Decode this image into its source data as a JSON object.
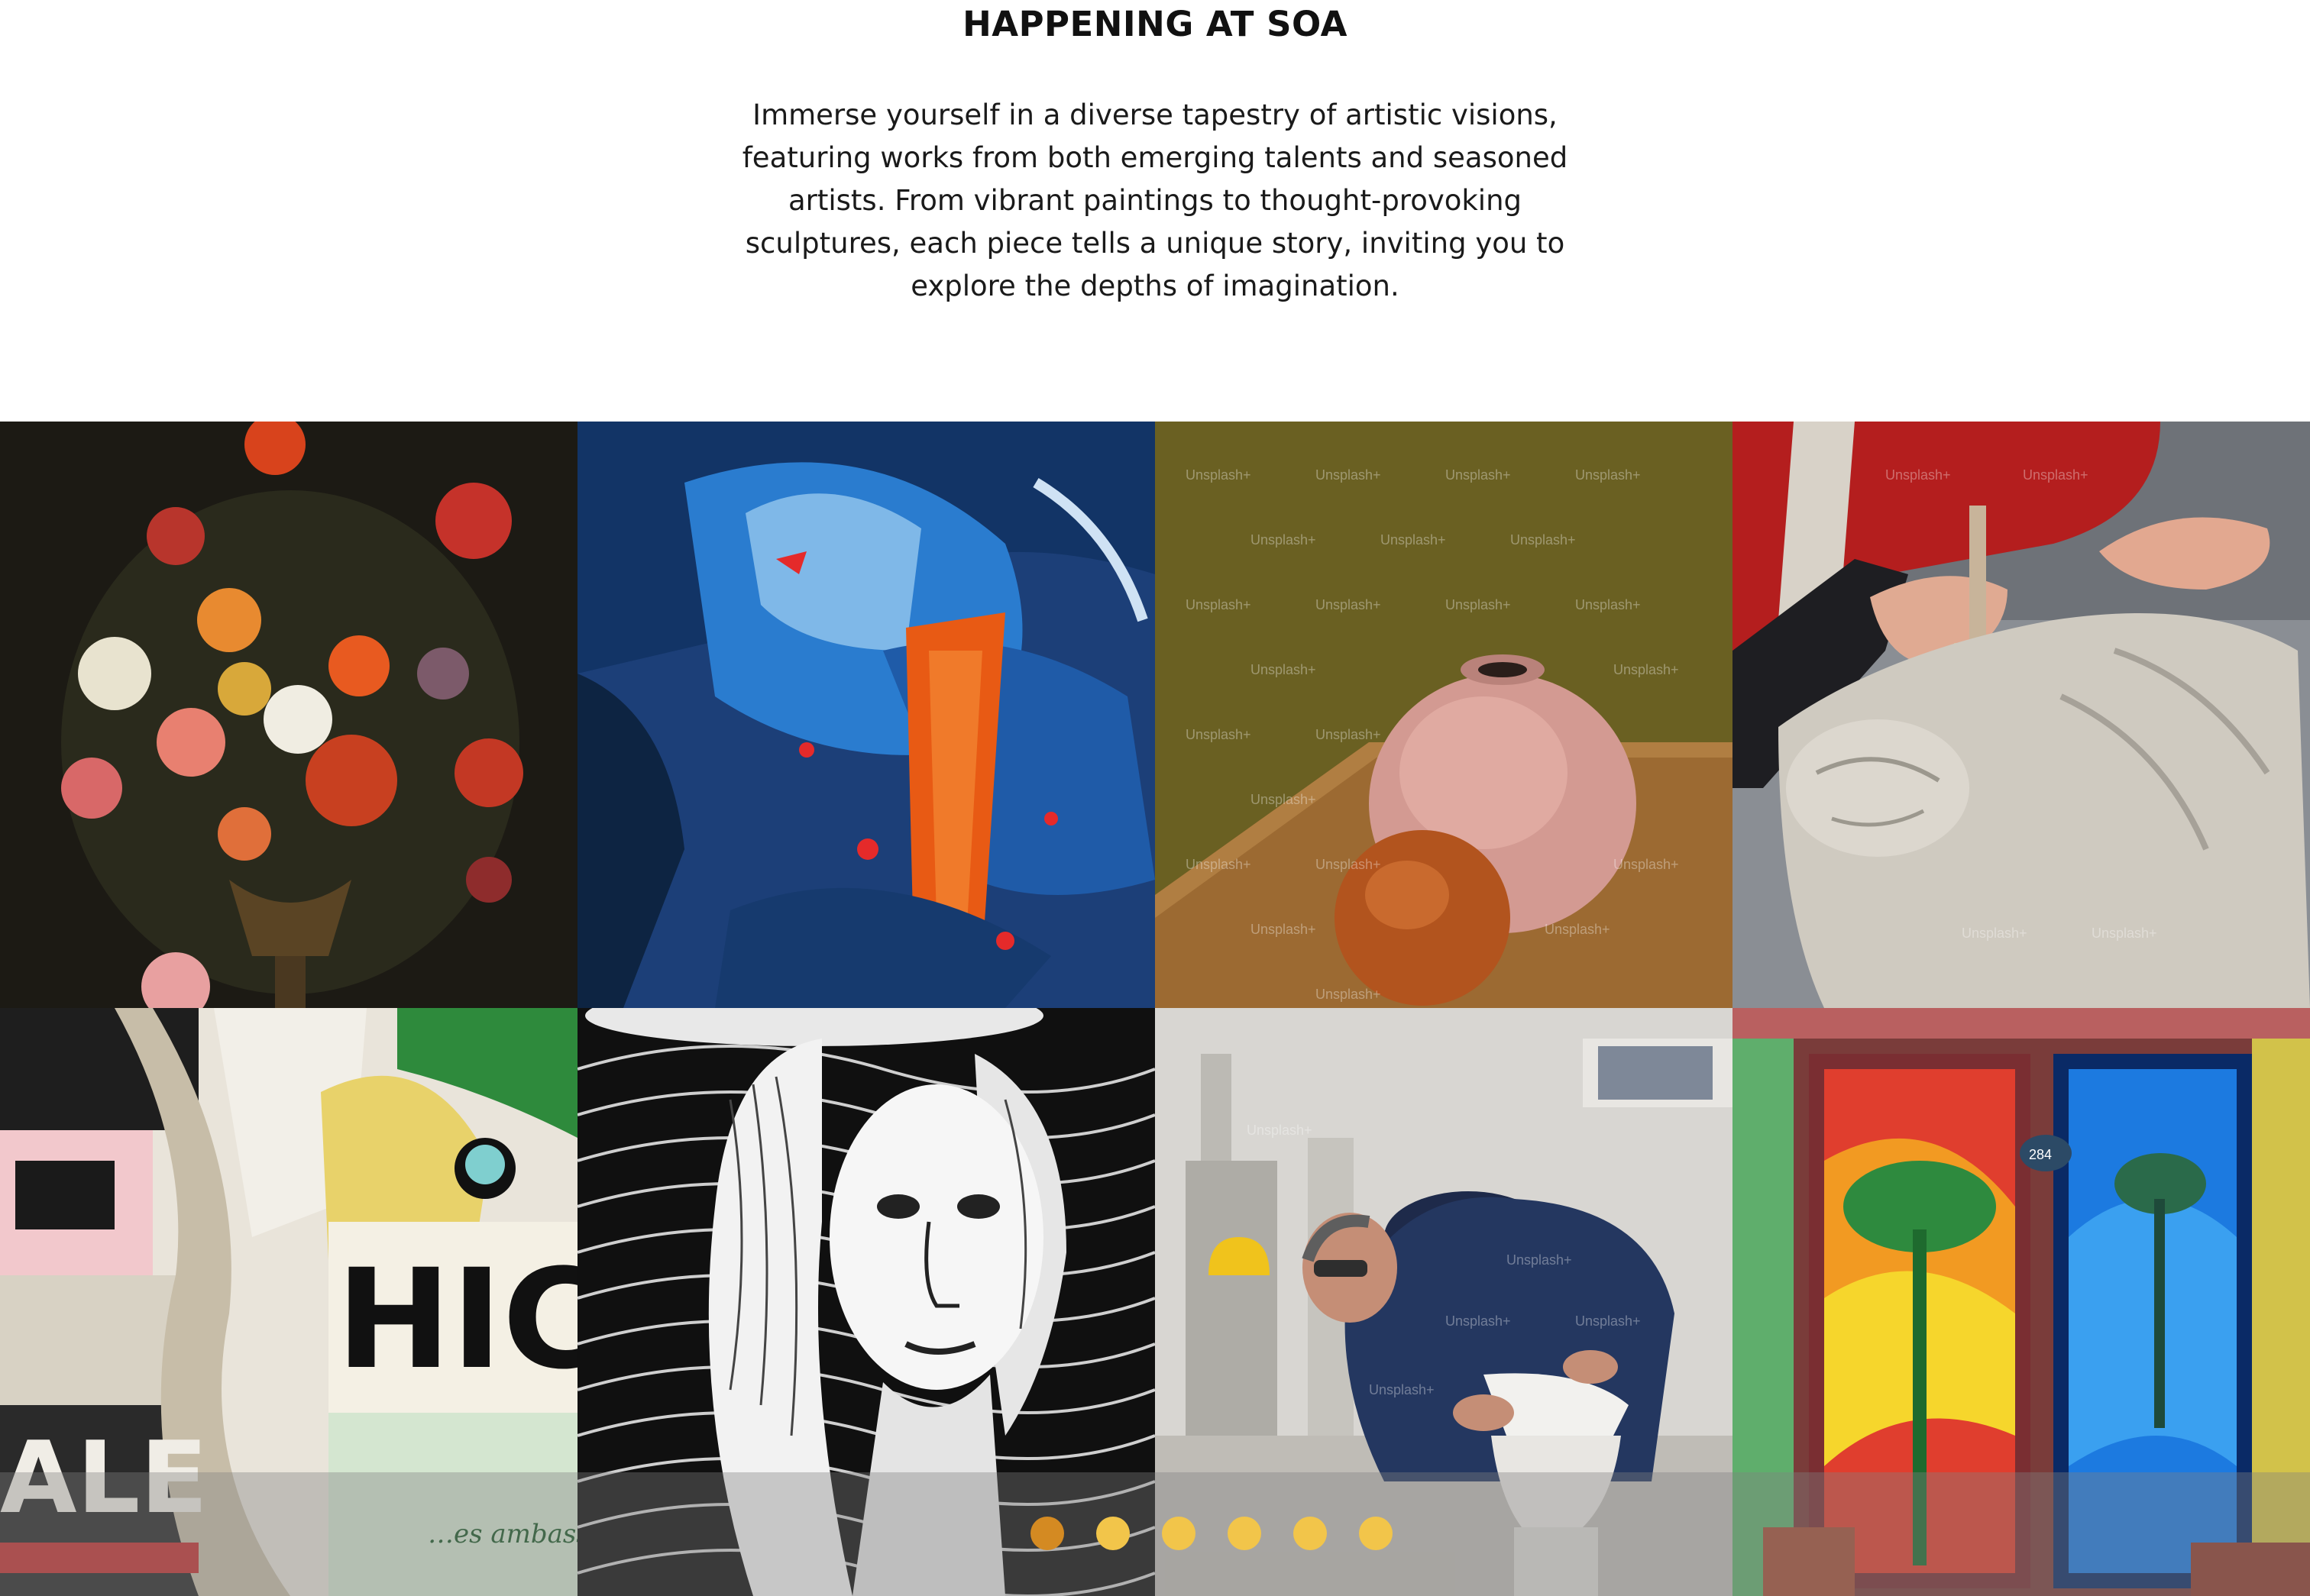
{
  "section": {
    "title": "HAPPENING AT SOA",
    "intro": "Immerse yourself in a diverse tapestry of artistic visions, featuring works from both emerging talents and seasoned artists. From vibrant paintings to thought-provoking sculptures, each piece tells a unique story, inviting you to explore the depths of imagination."
  },
  "watermark_text": "Unsplash+",
  "carousel": {
    "dot_count": 6,
    "active_index": 0,
    "active_color": "#d48a22",
    "inactive_color": "#f2c54a"
  }
}
